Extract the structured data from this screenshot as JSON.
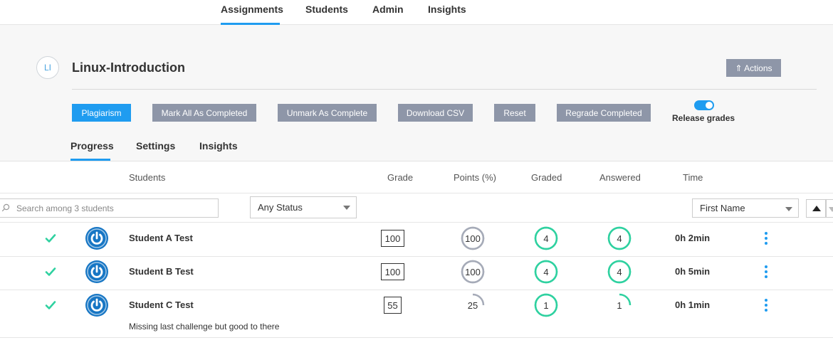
{
  "topnav": {
    "tabs": [
      "Assignments",
      "Students",
      "Admin",
      "Insights"
    ],
    "active": "Assignments"
  },
  "assignment": {
    "initials": "LI",
    "title": "Linux-Introduction",
    "actions_label": "⇑ Actions"
  },
  "toolbar": {
    "plagiarism": "Plagiarism",
    "mark_all": "Mark All As Completed",
    "unmark": "Unmark As Complete",
    "download_csv": "Download CSV",
    "reset": "Reset",
    "regrade": "Regrade Completed",
    "release_grades": "Release grades",
    "release_grades_on": true
  },
  "subtabs": [
    "Progress",
    "Settings",
    "Insights"
  ],
  "table": {
    "headers": {
      "students": "Students",
      "grade": "Grade",
      "points": "Points (%)",
      "graded": "Graded",
      "answered": "Answered",
      "time": "Time"
    },
    "search_placeholder": "Search among 3 students",
    "status_filter": "Any Status",
    "sort_by": "First Name",
    "rows": [
      {
        "name": "Student A Test",
        "grade": "100",
        "points": "100",
        "points_pct": 100,
        "graded": "4",
        "graded_pct": 100,
        "answered": "4",
        "answered_pct": 100,
        "time": "0h 2min",
        "comment": ""
      },
      {
        "name": "Student B Test",
        "grade": "100",
        "points": "100",
        "points_pct": 100,
        "graded": "4",
        "graded_pct": 100,
        "answered": "4",
        "answered_pct": 100,
        "time": "0h 5min",
        "comment": ""
      },
      {
        "name": "Student C Test",
        "grade": "55",
        "points": "25",
        "points_pct": 25,
        "graded": "1",
        "graded_pct": 100,
        "answered": "1",
        "answered_pct": 25,
        "time": "0h 1min",
        "comment": "Missing last challenge but good to there"
      }
    ]
  },
  "colors": {
    "accent": "#1f9cf0",
    "button_gray": "#8e96a8",
    "success": "#2fd1a0",
    "ring_gray": "#a6abb8",
    "avatar_blue": "#1776c4"
  }
}
